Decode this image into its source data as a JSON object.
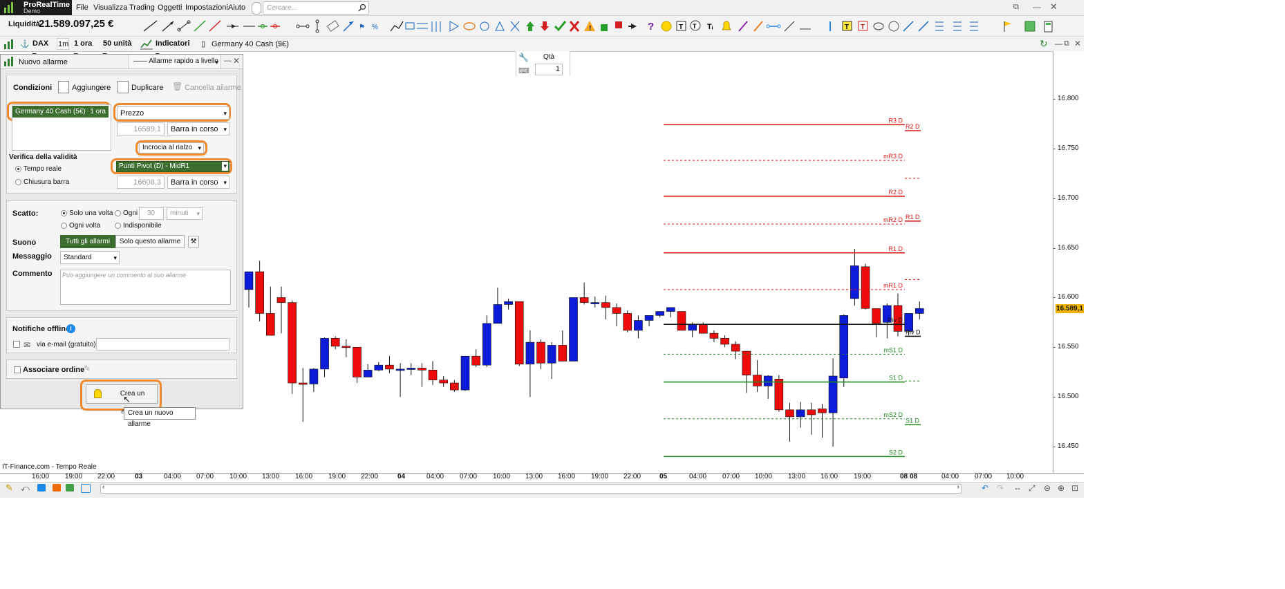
{
  "app": {
    "brand": "ProRealTime",
    "mode": "Demo"
  },
  "menu": [
    "File",
    "Visualizza",
    "Trading",
    "Oggetti",
    "Impostazioni",
    "Aiuto"
  ],
  "search": {
    "placeholder": "Cercare..."
  },
  "account": {
    "label": "Liquidità",
    "value": "21.589.097,25 €"
  },
  "chart_toolbar": {
    "instrument": "DAX",
    "interval_short": "1m",
    "timeframe": "1 ora",
    "units": "50 unità",
    "indicators": "Indicatori",
    "title": "Germany 40 Cash (5€)"
  },
  "order_box": {
    "qty_label": "Qtà",
    "qty_value": "1"
  },
  "panel": {
    "title": "Nuovo allarme",
    "mode": "—— Allarme rapido a livello",
    "conditions_label": "Condizioni",
    "add": "Aggiungere",
    "duplicate": "Duplicare",
    "delete": "Cancella allarme",
    "instrument": "Germany 40 Cash (5€)",
    "instrument_tf": "1 ora",
    "price_select": "Prezzo",
    "price_value": "16589,1",
    "bar_select_1": "Barra in corso",
    "cross": "Incrocia al rialzo",
    "pivot_select": "Punti Pivot (D)  - MidR1",
    "pivot_value": "16608,3",
    "bar_select_2": "Barra in corso",
    "validity_label": "Verifica della validità",
    "realtime": "Tempo reale",
    "barclose": "Chiusura barra",
    "trigger_label": "Scatto:",
    "once": "Solo una volta",
    "every": "Ogni",
    "every_value": "30",
    "every_unit": "minuti",
    "each_time": "Ogni volta",
    "unavailable": "Indisponibile",
    "sound_label": "Suono",
    "sound_all": "Tutti gli allarmi",
    "sound_this": "Solo questo allarme",
    "message_label": "Messaggio",
    "message_value": "Standard",
    "comment_label": "Commento",
    "comment_placeholder": "Può aggiungere un commento al suo allarme",
    "offline_label": "Notifiche offline",
    "email": "via e-mail (gratuito)",
    "order_label": "Associare ordine",
    "create": "Crea un allarme",
    "tooltip": "Crea un nuovo allarme"
  },
  "chart_footer": "IT-Finance.com - Tempo Reale",
  "last_price": "16.589,1",
  "colors": {
    "up": "#0b1bd8",
    "down": "#ee0b0b",
    "highlight": "#ef8a2e",
    "panel_green": "#3c6e2f"
  },
  "chart_data": {
    "type": "candlestick",
    "yticks": [
      "16.800",
      "16.750",
      "16.700",
      "16.650",
      "16.600",
      "16.550",
      "16.500",
      "16.450"
    ],
    "xticks": [
      "16:00",
      "19:00",
      "22:00",
      "03",
      "04:00",
      "07:00",
      "10:00",
      "13:00",
      "16:00",
      "19:00",
      "22:00",
      "04",
      "04:00",
      "07:00",
      "10:00",
      "13:00",
      "16:00",
      "19:00",
      "22:00",
      "05",
      "04:00",
      "07:00",
      "10:00",
      "13:00",
      "16:00",
      "19:00",
      "08",
      "08",
      "04:00",
      "07:00",
      "10:00"
    ],
    "xticks_bold": [
      3,
      11,
      19,
      26,
      27
    ],
    "candles": [
      {
        "o": 16608,
        "h": 16618,
        "l": 16590,
        "c": 16626
      },
      {
        "o": 16626,
        "h": 16637,
        "l": 16576,
        "c": 16584
      },
      {
        "o": 16584,
        "h": 16611,
        "l": 16564,
        "c": 16562
      },
      {
        "o": 16600,
        "h": 16611,
        "l": 16564,
        "c": 16595
      },
      {
        "o": 16595,
        "h": 16597,
        "l": 16503,
        "c": 16514
      },
      {
        "o": 16514,
        "h": 16529,
        "l": 16475,
        "c": 16513
      },
      {
        "o": 16513,
        "h": 16529,
        "l": 16505,
        "c": 16528
      },
      {
        "o": 16528,
        "h": 16560,
        "l": 16520,
        "c": 16559
      },
      {
        "o": 16559,
        "h": 16561,
        "l": 16548,
        "c": 16551
      },
      {
        "o": 16551,
        "h": 16558,
        "l": 16540,
        "c": 16550
      },
      {
        "o": 16550,
        "h": 16550,
        "l": 16514,
        "c": 16520
      },
      {
        "o": 16520,
        "h": 16533,
        "l": 16520,
        "c": 16527
      },
      {
        "o": 16527,
        "h": 16535,
        "l": 16526,
        "c": 16532
      },
      {
        "o": 16532,
        "h": 16541,
        "l": 16524,
        "c": 16528
      },
      {
        "o": 16528,
        "h": 16534,
        "l": 16500,
        "c": 16528
      },
      {
        "o": 16528,
        "h": 16534,
        "l": 16522,
        "c": 16529
      },
      {
        "o": 16529,
        "h": 16534,
        "l": 16510,
        "c": 16527
      },
      {
        "o": 16527,
        "h": 16536,
        "l": 16512,
        "c": 16517
      },
      {
        "o": 16517,
        "h": 16521,
        "l": 16510,
        "c": 16514
      },
      {
        "o": 16514,
        "h": 16517,
        "l": 16505,
        "c": 16507
      },
      {
        "o": 16507,
        "h": 16541,
        "l": 16506,
        "c": 16541
      },
      {
        "o": 16541,
        "h": 16548,
        "l": 16530,
        "c": 16532
      },
      {
        "o": 16532,
        "h": 16582,
        "l": 16530,
        "c": 16574
      },
      {
        "o": 16574,
        "h": 16610,
        "l": 16574,
        "c": 16593
      },
      {
        "o": 16593,
        "h": 16599,
        "l": 16588,
        "c": 16596
      },
      {
        "o": 16596,
        "h": 16596,
        "l": 16531,
        "c": 16533
      },
      {
        "o": 16533,
        "h": 16567,
        "l": 16500,
        "c": 16555
      },
      {
        "o": 16555,
        "h": 16558,
        "l": 16528,
        "c": 16534
      },
      {
        "o": 16534,
        "h": 16555,
        "l": 16518,
        "c": 16552
      },
      {
        "o": 16552,
        "h": 16567,
        "l": 16540,
        "c": 16536
      },
      {
        "o": 16536,
        "h": 16600,
        "l": 16536,
        "c": 16600
      },
      {
        "o": 16600,
        "h": 16615,
        "l": 16593,
        "c": 16595
      },
      {
        "o": 16595,
        "h": 16601,
        "l": 16590,
        "c": 16595
      },
      {
        "o": 16595,
        "h": 16602,
        "l": 16578,
        "c": 16590
      },
      {
        "o": 16590,
        "h": 16594,
        "l": 16571,
        "c": 16584
      },
      {
        "o": 16584,
        "h": 16587,
        "l": 16565,
        "c": 16567
      },
      {
        "o": 16567,
        "h": 16582,
        "l": 16559,
        "c": 16577
      },
      {
        "o": 16577,
        "h": 16580,
        "l": 16571,
        "c": 16582
      },
      {
        "o": 16582,
        "h": 16584,
        "l": 16580,
        "c": 16586
      },
      {
        "o": 16586,
        "h": 16590,
        "l": 16580,
        "c": 16590
      },
      {
        "o": 16586,
        "h": 16586,
        "l": 16569,
        "c": 16567
      },
      {
        "o": 16567,
        "h": 16575,
        "l": 16560,
        "c": 16573
      },
      {
        "o": 16573,
        "h": 16575,
        "l": 16566,
        "c": 16564
      },
      {
        "o": 16564,
        "h": 16567,
        "l": 16555,
        "c": 16559
      },
      {
        "o": 16559,
        "h": 16562,
        "l": 16550,
        "c": 16553
      },
      {
        "o": 16553,
        "h": 16556,
        "l": 16538,
        "c": 16546
      },
      {
        "o": 16546,
        "h": 16546,
        "l": 16504,
        "c": 16522
      },
      {
        "o": 16522,
        "h": 16537,
        "l": 16505,
        "c": 16511
      },
      {
        "o": 16511,
        "h": 16522,
        "l": 16498,
        "c": 16521
      },
      {
        "o": 16518,
        "h": 16522,
        "l": 16485,
        "c": 16487
      },
      {
        "o": 16487,
        "h": 16494,
        "l": 16455,
        "c": 16480
      },
      {
        "o": 16480,
        "h": 16495,
        "l": 16469,
        "c": 16487
      },
      {
        "o": 16487,
        "h": 16494,
        "l": 16462,
        "c": 16482
      },
      {
        "o": 16488,
        "h": 16493,
        "l": 16459,
        "c": 16484
      },
      {
        "o": 16484,
        "h": 16539,
        "l": 16450,
        "c": 16521
      },
      {
        "o": 16519,
        "h": 16583,
        "l": 16510,
        "c": 16582
      },
      {
        "o": 16599,
        "h": 16649,
        "l": 16592,
        "c": 16632
      },
      {
        "o": 16631,
        "h": 16634,
        "l": 16588,
        "c": 16589
      },
      {
        "o": 16589,
        "h": 16587,
        "l": 16560,
        "c": 16574
      },
      {
        "o": 16575,
        "h": 16594,
        "l": 16559,
        "c": 16592
      },
      {
        "o": 16592,
        "h": 16604,
        "l": 16561,
        "c": 16566
      },
      {
        "o": 16566,
        "h": 16580,
        "l": 16562,
        "c": 16584
      },
      {
        "o": 16584,
        "h": 16596,
        "l": 16578,
        "c": 16589
      }
    ],
    "pivot_levels": [
      {
        "label": "R3 D",
        "value": 16774,
        "style": "solid",
        "color": "#dd1515"
      },
      {
        "label": "mR3 D",
        "value": 16738,
        "style": "dashed",
        "color": "#dd1515"
      },
      {
        "label": "R2 D",
        "value": 16702,
        "style": "solid",
        "color": "#dd1515"
      },
      {
        "label": "mR2 D",
        "value": 16674,
        "style": "dashed",
        "color": "#dd1515"
      },
      {
        "label": "R1 D",
        "value": 16645,
        "style": "solid",
        "color": "#dd1515"
      },
      {
        "label": "mR1 D",
        "value": 16608,
        "style": "dashed",
        "color": "#dd1515"
      },
      {
        "label": "Piv D",
        "value": 16573,
        "style": "solid",
        "color": "#111111"
      },
      {
        "label": "mS1 D",
        "value": 16543,
        "style": "dashed",
        "color": "#1f8a1f"
      },
      {
        "label": "S1 D",
        "value": 16515,
        "style": "solid",
        "color": "#1f8a1f"
      },
      {
        "label": "mS2 D",
        "value": 16478,
        "style": "dashed",
        "color": "#1f8a1f"
      },
      {
        "label": "S2 D",
        "value": 16440,
        "style": "solid",
        "color": "#1f8a1f"
      }
    ],
    "pivot_levels_next": [
      {
        "label": "R2 D",
        "value": 16768,
        "style": "solid",
        "color": "#dd1515"
      },
      {
        "label": "",
        "value": 16720,
        "style": "dashed",
        "color": "#dd1515"
      },
      {
        "label": "R1 D",
        "value": 16677,
        "style": "solid",
        "color": "#dd1515"
      },
      {
        "label": "",
        "value": 16618,
        "style": "dashed",
        "color": "#dd1515"
      },
      {
        "label": "Piv D",
        "value": 16561,
        "style": "solid",
        "color": "#111111"
      },
      {
        "label": "",
        "value": 16516,
        "style": "dashed",
        "color": "#1f8a1f"
      },
      {
        "label": "S1 D",
        "value": 16472,
        "style": "solid",
        "color": "#1f8a1f"
      }
    ],
    "ylim": [
      16420,
      16820
    ]
  }
}
